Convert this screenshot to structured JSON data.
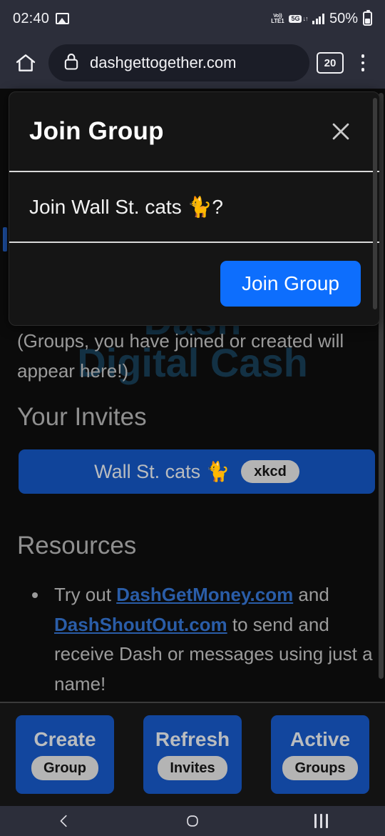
{
  "statusbar": {
    "clock": "02:40",
    "photo_icon": "image-icon",
    "network_label_top": "Vo))",
    "network_label_bottom": "LTE1",
    "g5_badge": "5G",
    "g5_arrows": "↓↑",
    "battery_percent": "50%"
  },
  "browser": {
    "home_icon": "home-icon",
    "lock_icon": "lock-icon",
    "url": "dashgettogether.com",
    "tab_count": "20",
    "menu_icon": "kebab-menu-icon"
  },
  "page": {
    "watermark_line1": "Dash",
    "watermark_line2": "Digital Cash",
    "groups_note": "(Groups, you have joined or created will appear here!)",
    "invites_heading": "Your Invites",
    "invites": [
      {
        "name": "Wall St. cats 🐈",
        "badge": "xkcd"
      }
    ],
    "resources_heading": "Resources",
    "resources": [
      {
        "prefix": "Try out ",
        "link1": "DashGetMoney.com",
        "middle": " and ",
        "link2": "DashShoutOut.com",
        "suffix": " to send and receive Dash or messages using just a name!"
      }
    ]
  },
  "actionbar": {
    "buttons": [
      {
        "top": "Create",
        "pill": "Group"
      },
      {
        "top": "Refresh",
        "pill": "Invites"
      },
      {
        "top": "Active",
        "pill": "Groups"
      }
    ]
  },
  "modal": {
    "title": "Join Group",
    "close_icon": "close-icon",
    "body_text": "Join Wall St. cats 🐈?",
    "confirm_label": "Join Group",
    "accent_color": "#0d6efd"
  },
  "navbar": {
    "back_icon": "back-chevron-icon",
    "home_icon": "home-circle-icon",
    "recents_icon": "recents-icon"
  }
}
